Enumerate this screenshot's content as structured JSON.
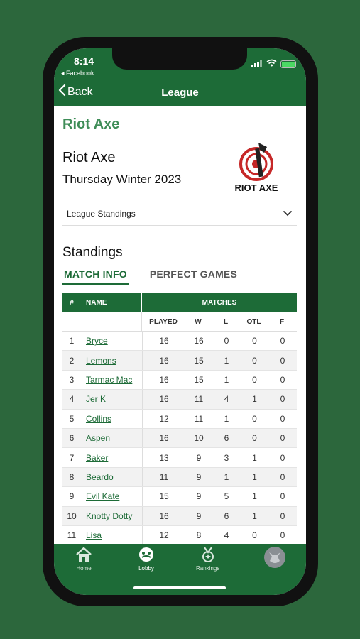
{
  "status_bar": {
    "time": "8:14",
    "source": "◂ Facebook"
  },
  "nav": {
    "back_label": "Back",
    "title": "League"
  },
  "league": {
    "name": "Riot Axe",
    "team": "Riot Axe",
    "season": "Thursday Winter 2023",
    "logo_text": "RIOT AXE"
  },
  "dropdown": {
    "selected": "League Standings"
  },
  "standings": {
    "title": "Standings",
    "tabs": [
      "MATCH INFO",
      "PERFECT GAMES"
    ],
    "header": {
      "rank": "#",
      "name": "NAME",
      "matches": "MATCHES"
    },
    "columns": [
      "PLAYED",
      "W",
      "L",
      "OTL",
      "F"
    ],
    "rows": [
      {
        "rank": "1",
        "name": "Bryce",
        "played": "16",
        "w": "16",
        "l": "0",
        "otl": "0",
        "f": "0"
      },
      {
        "rank": "2",
        "name": "Lemons",
        "played": "16",
        "w": "15",
        "l": "1",
        "otl": "0",
        "f": "0"
      },
      {
        "rank": "3",
        "name": "Tarmac Mac",
        "played": "16",
        "w": "15",
        "l": "1",
        "otl": "0",
        "f": "0"
      },
      {
        "rank": "4",
        "name": "Jer K",
        "played": "16",
        "w": "11",
        "l": "4",
        "otl": "1",
        "f": "0"
      },
      {
        "rank": "5",
        "name": "Collins",
        "played": "12",
        "w": "11",
        "l": "1",
        "otl": "0",
        "f": "0"
      },
      {
        "rank": "6",
        "name": "Aspen",
        "played": "16",
        "w": "10",
        "l": "6",
        "otl": "0",
        "f": "0"
      },
      {
        "rank": "7",
        "name": "Baker",
        "played": "13",
        "w": "9",
        "l": "3",
        "otl": "1",
        "f": "0"
      },
      {
        "rank": "8",
        "name": "Beardo",
        "played": "11",
        "w": "9",
        "l": "1",
        "otl": "1",
        "f": "0"
      },
      {
        "rank": "9",
        "name": "Evil Kate",
        "played": "15",
        "w": "9",
        "l": "5",
        "otl": "1",
        "f": "0"
      },
      {
        "rank": "10",
        "name": "Knotty Dotty",
        "played": "16",
        "w": "9",
        "l": "6",
        "otl": "1",
        "f": "0"
      },
      {
        "rank": "11",
        "name": "Lisa",
        "played": "12",
        "w": "8",
        "l": "4",
        "otl": "0",
        "f": "0"
      }
    ]
  },
  "tabbar": {
    "items": [
      "Home",
      "Lobby",
      "Rankings"
    ]
  },
  "colors": {
    "brand_green": "#1d6b37",
    "accent_green": "#3f8d58",
    "background": "#2c673c"
  }
}
